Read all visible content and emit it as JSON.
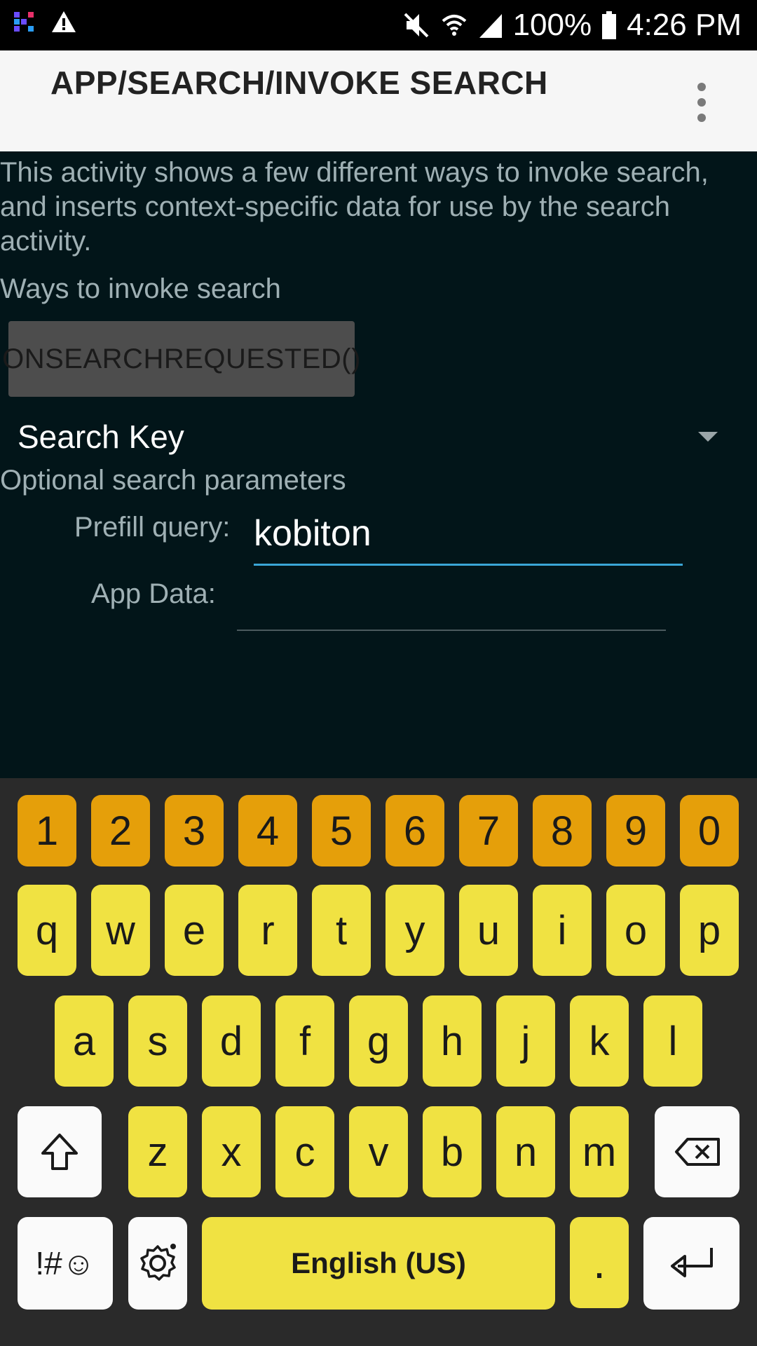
{
  "status_bar": {
    "battery": "100%",
    "time": "4:26 PM",
    "icons": [
      "kobiton-app-icon",
      "warning-icon",
      "mute-icon",
      "wifi-icon",
      "signal-icon",
      "battery-icon"
    ]
  },
  "app_bar": {
    "title": "APP/SEARCH/INVOKE SEARCH",
    "overflow_icon": "more-vert-icon"
  },
  "content": {
    "description": "This activity shows a few different ways to invoke search, and inserts context-specific data for use by the search activity.",
    "ways_label": "Ways to invoke search",
    "onsearch_button": "ONSEARCHREQUESTED()",
    "spinner_selected": "Search Key",
    "optional_label": "Optional search parameters",
    "prefill_label": "Prefill query:",
    "prefill_value": "kobiton",
    "appdata_label": "App Data:",
    "appdata_value": ""
  },
  "colors": {
    "background": "#021519",
    "app_bar": "#f6f6f6",
    "accent": "#3aa6d6",
    "number_key": "#e59f0a",
    "letter_key": "#f0e242",
    "keyboard_bg": "#2a2a2a"
  },
  "keyboard": {
    "numbers": [
      "1",
      "2",
      "3",
      "4",
      "5",
      "6",
      "7",
      "8",
      "9",
      "0"
    ],
    "row1": [
      "q",
      "w",
      "e",
      "r",
      "t",
      "y",
      "u",
      "i",
      "o",
      "p"
    ],
    "row2": [
      "a",
      "s",
      "d",
      "f",
      "g",
      "h",
      "j",
      "k",
      "l"
    ],
    "row3": [
      "z",
      "x",
      "c",
      "v",
      "b",
      "n",
      "m"
    ],
    "symbols_label": "!#☺",
    "space_label": "English (US)",
    "period_label": ".",
    "special_icons": [
      "shift-icon",
      "backspace-icon",
      "settings-icon",
      "enter-icon"
    ]
  }
}
